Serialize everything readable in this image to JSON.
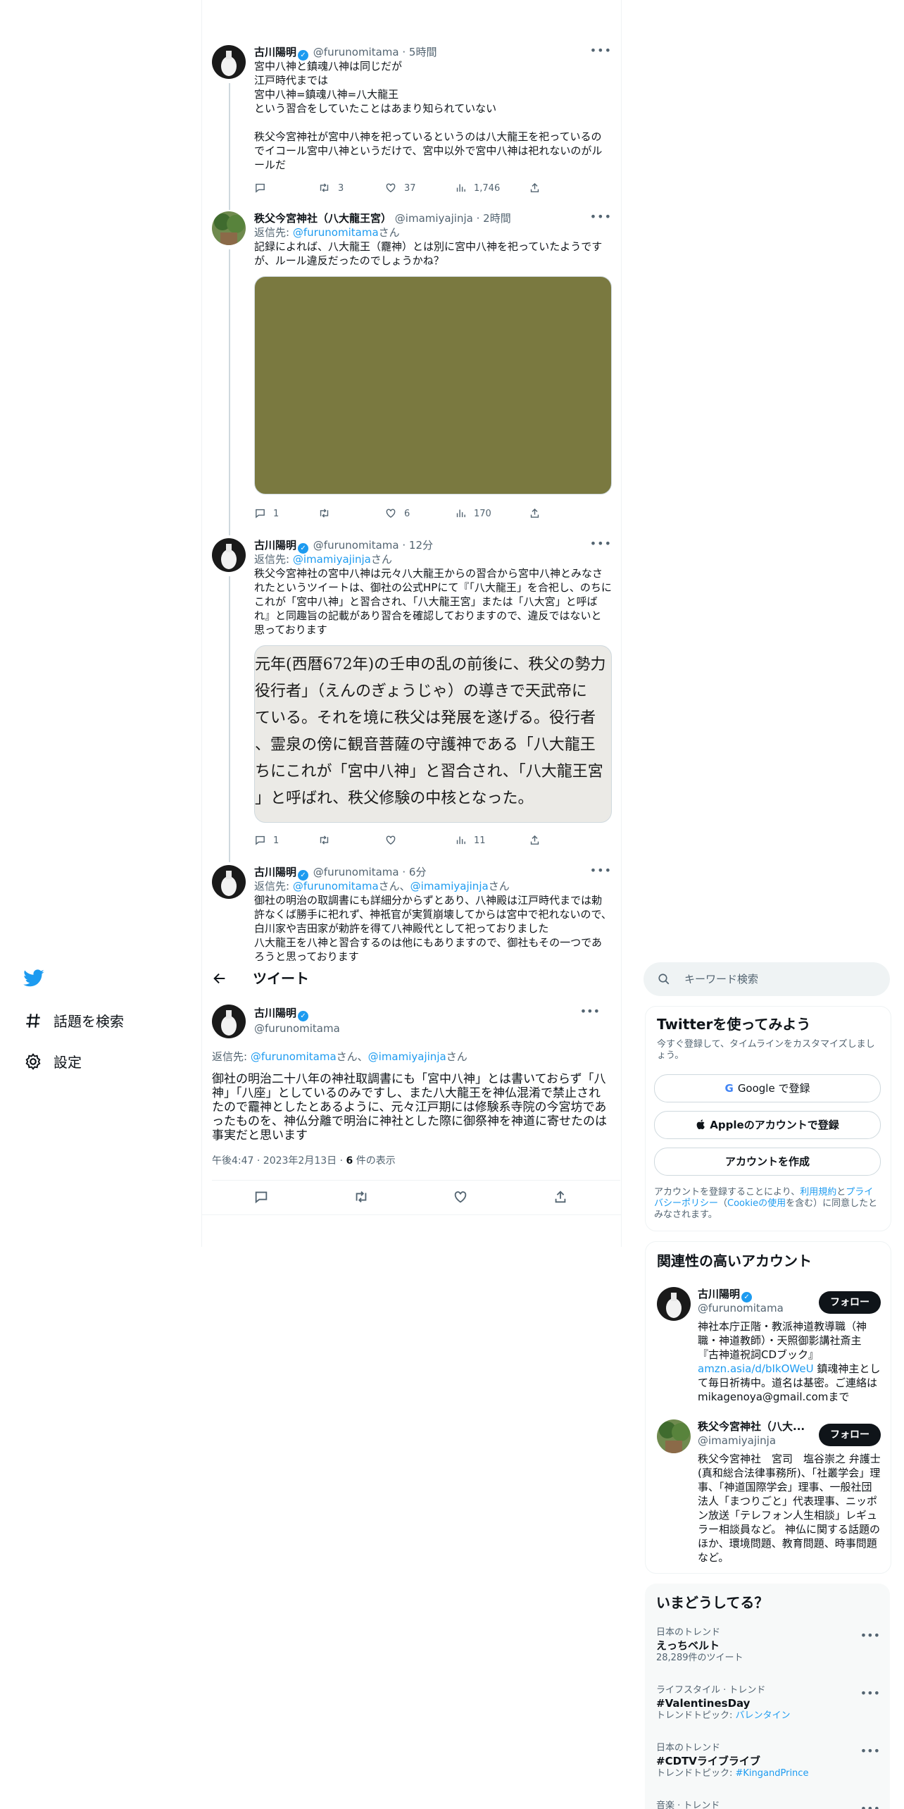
{
  "thread": [
    {
      "name": "古川陽明",
      "handle": "@furunomitama",
      "time": "· 5時間",
      "text": "宮中八神と鎮魂八神は同じだが\n江戸時代までは\n宮中八神=鎮魂八神=八大龍王\nという習合をしていたことはあまり知られていない\n\n秩父今宮神社が宮中八神を祀っているというのは八大龍王を祀っているのでイコール宮中八神というだけで、宮中以外で宮中八神は祀れないのがルールだ",
      "replies": "",
      "retweets": "3",
      "likes": "37",
      "views": "1,746"
    },
    {
      "name": "秩父今宮神社（八大龍王宮）",
      "handle": "@imamiyajinja",
      "time": "· 2時間",
      "reply_prefix": "返信先: ",
      "reply_to": "@furunomitama",
      "reply_suffix": "さん",
      "text": "記録によれば、八大龍王（龗神）とは別に宮中八神を祀っていたようですが、ルール違反だったのでしょうかね？",
      "image_color": "#7a7940",
      "replies": "1",
      "retweets": "",
      "likes": "6",
      "views": "170"
    },
    {
      "name": "古川陽明",
      "handle": "@furunomitama",
      "time": "· 12分",
      "reply_prefix": "返信先: ",
      "reply_to": "@imamiyajinja",
      "reply_suffix": "さん",
      "text": "秩父今宮神社の宮中八神は元々八大龍王からの習合から宮中八神とみなされたというツイートは、御社の公式HPにて『「八大龍王」を合祀し、のちにこれが「宮中八神」と習合され、「八大龍王宮」または「八大宮」と呼ばれ』と同趣旨の記載があり習合を確認しておりますので、違反ではないと思っております",
      "image_lines": [
        "元年(西暦672年)の壬申の乱の前後に、秩父の勢力",
        "役行者」（えんのぎょうじゃ）の導きで天武帝に",
        "ている。それを境に秩父は発展を遂げる。役行者",
        "、霊泉の傍に観音菩薩の守護神である「八大龍王",
        "ちにこれが「宮中八神」と習合され、「八大龍王宮",
        "」と呼ばれ、秩父修験の中核となった。"
      ],
      "replies": "1",
      "retweets": "",
      "likes": "",
      "views": "11"
    },
    {
      "name": "古川陽明",
      "handle": "@furunomitama",
      "time": "· 6分",
      "reply_prefix": "返信先: ",
      "reply_to": "@furunomitama",
      "reply_mid": "さん、",
      "reply_to2": "@imamiyajinja",
      "reply_suffix": "さん",
      "text": "御社の明治の取調書にも詳細分からずとあり、八神殿は江戸時代までは勅許なくば勝手に祀れず、神祇官が実質崩壊してからは宮中で祀れないので、白川家や吉田家が勅許を得て八神殿代として祀っておりました\n八大龍王を八神と習合するのは他にもありますので、御社もその一つであろうと思っております"
    }
  ],
  "header": {
    "title": "ツイート"
  },
  "main_tweet": {
    "name": "古川陽明",
    "handle": "@furunomitama",
    "reply_prefix": "返信先: ",
    "reply_to": "@furunomitama",
    "reply_mid": "さん、",
    "reply_to2": "@imamiyajinja",
    "reply_suffix": "さん",
    "text": "御社の明治二十八年の神社取調書にも「宮中八神」とは書いておらず「八神」「八座」としているのみですし、また八大龍王を神仏混淆で禁止されたので龗神としたとあるように、元々江戸期には修験系寺院の今宮坊であったものを、神仏分離で明治に神社とした際に御祭神を神道に寄せたのは事実だと思います",
    "timestamp": "午後4:47 · 2023年2月13日 · ",
    "views_count": "6",
    "views_label": " 件の表示"
  },
  "nav": {
    "explore": "話題を検索",
    "settings": "設定"
  },
  "search": {
    "placeholder": "キーワード検索"
  },
  "signup": {
    "title": "Twitterを使ってみよう",
    "subtitle": "今すぐ登録して、タイムラインをカスタマイズしましょう。",
    "google": "Google で登録",
    "apple": "Appleのアカウントで登録",
    "create": "アカウントを作成",
    "legal_1": "アカウントを登録することにより、",
    "legal_terms": "利用規約",
    "legal_2": "と",
    "legal_privacy": "プライバシーポリシー",
    "legal_3": "（",
    "legal_cookie": "Cookieの使用",
    "legal_4": "を含む）に同意したとみなされます。"
  },
  "related": {
    "title": "関連性の高いアカウント",
    "follow": "フォロー",
    "accounts": [
      {
        "name": "古川陽明",
        "handle": "@furunomitama",
        "bio_1": "神社本庁正階・教派神道教導職（神職・神道教師）・天照御影講社斎主『古神道祝詞CDブック』",
        "bio_link": "amzn.asia/d/bIkOWeU",
        "bio_2": " 鎮魂神主として毎日祈祷中。道名は基密。ご連絡はmikagenoya@gmail.comまで"
      },
      {
        "name": "秩父今宮神社（八大...",
        "handle": "@imamiyajinja",
        "bio_1": "秩父今宮神社　宮司　塩谷崇之 弁護士(真和総合法律事務所)、「社叢学会」理事、「神道国際学会」理事、一般社団法人「まつりごと」代表理事、ニッポン放送「テレフォン人生相談」レギュラー相談員など。 神仏に関する話題のほか、環境問題、教育問題、時事問題など。"
      }
    ]
  },
  "trends": {
    "title": "いまどうしてる？",
    "items": [
      {
        "context": "日本のトレンド",
        "name": "えっちベルト",
        "count": "28,289件のツイート"
      },
      {
        "context": "ライフスタイル · トレンド",
        "name": "#ValentinesDay",
        "topic_label": "トレンドトピック: ",
        "topic": "バレンタイン"
      },
      {
        "context": "日本のトレンド",
        "name": "#CDTVライブライブ",
        "topic_label": "トレンドトピック: ",
        "topic": "#KingandPrince"
      },
      {
        "context": "音楽 · トレンド"
      }
    ]
  },
  "colors": {
    "accent": "#1d9bf0",
    "text": "#0f1419",
    "secondary": "#536471",
    "border": "#eff3f4"
  }
}
